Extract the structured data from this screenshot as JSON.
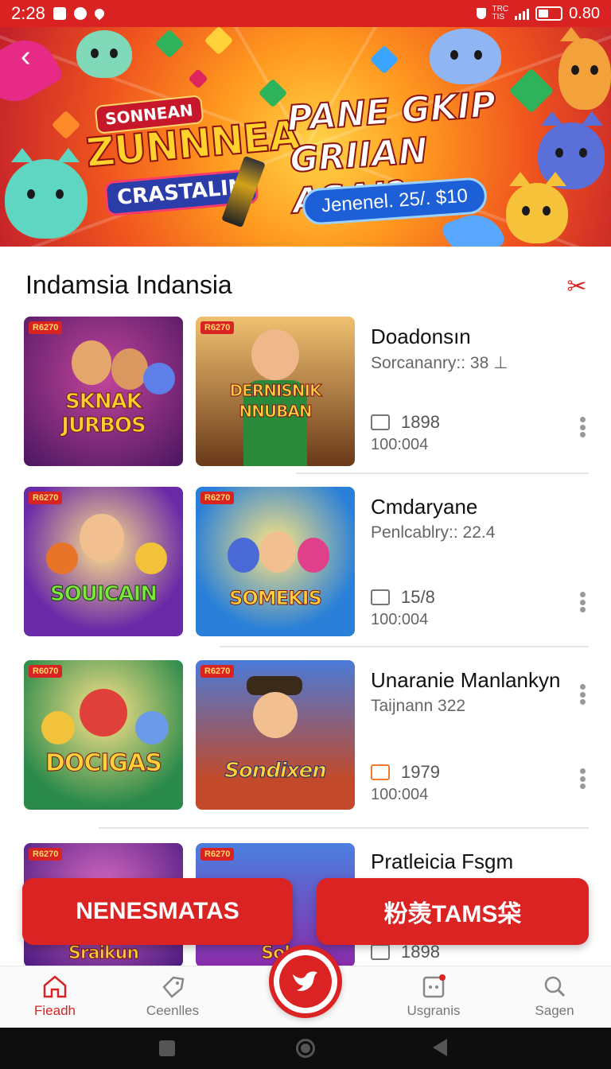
{
  "status_bar": {
    "time": "2:28",
    "carrier_top": "TRC",
    "carrier_bottom": "TIS",
    "battery_text": "0.80"
  },
  "banner": {
    "badge_text": "SONNEAN",
    "logo_main": "ZUNNNEA",
    "logo_sub": "CRASTALIN",
    "promo_title_line1": "PANE GKIP",
    "promo_title_line2": "GRIIAN ASAI?",
    "promo_pill": "Jenenel. 25/. $10"
  },
  "section": {
    "title": "Indamsia Indansia"
  },
  "list": [
    {
      "title": "Doadonsın",
      "subtitle": "Sorcananry:: 38 ⊥",
      "count": "1898",
      "time": "100:004",
      "art": [
        {
          "tag": "R6270",
          "text": "SKNAK JURBOS"
        },
        {
          "tag": "R6270",
          "text": "DERNISNIK NNUBAN"
        }
      ]
    },
    {
      "title": "Cmdaryane",
      "subtitle": "Penlcablry:: 22.4",
      "count": "15/8",
      "time": "100:004",
      "art": [
        {
          "tag": "R6270",
          "text": "SOUICAIN"
        },
        {
          "tag": "R6270",
          "text": "SOMEKIS"
        }
      ]
    },
    {
      "title": "Unaranie Manlankyn",
      "subtitle": "Taijnann 322",
      "count": "1979",
      "time": "100:004",
      "art": [
        {
          "tag": "R6070",
          "text": "DOCIGAS"
        },
        {
          "tag": "R6270",
          "text": "Sondixen"
        }
      ]
    },
    {
      "title": "Pratleicia Fsgm",
      "subtitle": "",
      "count": "1898",
      "time": "",
      "art": [
        {
          "tag": "R6270",
          "text": "Sraikun"
        },
        {
          "tag": "R6270",
          "text": "Sol"
        }
      ]
    }
  ],
  "actions": {
    "left_label": "NENESMATAS",
    "right_label": "粉羡TAMS柋"
  },
  "bottom_nav": {
    "items": [
      {
        "label": "Fieadh",
        "icon": "home-icon"
      },
      {
        "label": "Ceenlles",
        "icon": "tag-icon"
      },
      {
        "label": "Usgranis",
        "icon": "apps-icon"
      },
      {
        "label": "Sagen",
        "icon": "search-icon"
      }
    ],
    "center_icon": "bird-icon"
  },
  "colors": {
    "accent": "#d92323",
    "text": "#111111",
    "muted": "#666666"
  }
}
